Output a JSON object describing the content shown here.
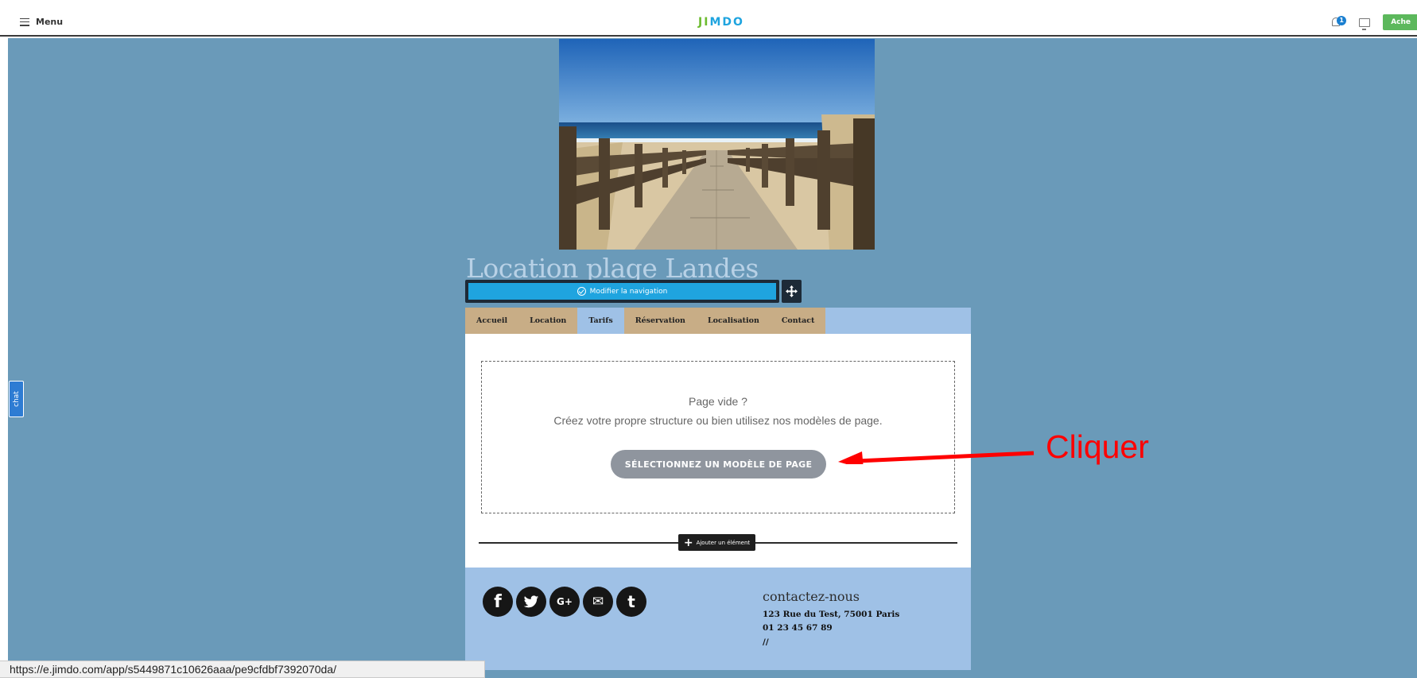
{
  "topbar": {
    "menu_label": "Menu",
    "logo": [
      "J",
      "I",
      "M",
      "D",
      "O"
    ],
    "logo_colors": [
      "#6cbb2f",
      "#6cbb2f",
      "#1fa4df",
      "#1fa4df",
      "#1fa4df"
    ],
    "notification_count": "1",
    "buy_label": "Ache"
  },
  "chat": {
    "label": "chat"
  },
  "site": {
    "title": "Location plage Landes",
    "nav_edit_label": "Modifier la navigation",
    "nav": [
      {
        "label": "Accueil",
        "active": false
      },
      {
        "label": "Location",
        "active": false
      },
      {
        "label": "Tarifs",
        "active": true
      },
      {
        "label": "Réservation",
        "active": false
      },
      {
        "label": "Localisation",
        "active": false
      },
      {
        "label": "Contact",
        "active": false
      }
    ],
    "empty_page": {
      "title": "Page vide ?",
      "subtitle": "Créez votre propre structure ou bien utilisez nos modèles de page.",
      "button": "SÉLECTIONNEZ UN MODÈLE DE PAGE"
    },
    "add_element_label": "Ajouter un élément",
    "footer": {
      "social_icons": [
        "facebook-icon",
        "twitter-icon",
        "google-plus-icon",
        "email-icon",
        "tumblr-icon"
      ],
      "social_glyphs": [
        "f",
        "t",
        "G+",
        "✉",
        "t"
      ],
      "contact_heading": "contactez-nous",
      "address": "123 Rue du Test, 75001 Paris",
      "phone": "01 23 45 67 89",
      "extra": "//"
    }
  },
  "annotation": {
    "text": "Cliquer",
    "color": "#ff0000"
  },
  "status_bar": {
    "url": "https://e.jimdo.com/app/s5449871c10626aaa/pe9cfdbf7392070da/"
  },
  "colors": {
    "canvas_bg": "#6a9ab9",
    "accent_blue": "#1fa4df",
    "nav_bg": "#c8ad86",
    "footer_bg": "#9fc1e6"
  }
}
